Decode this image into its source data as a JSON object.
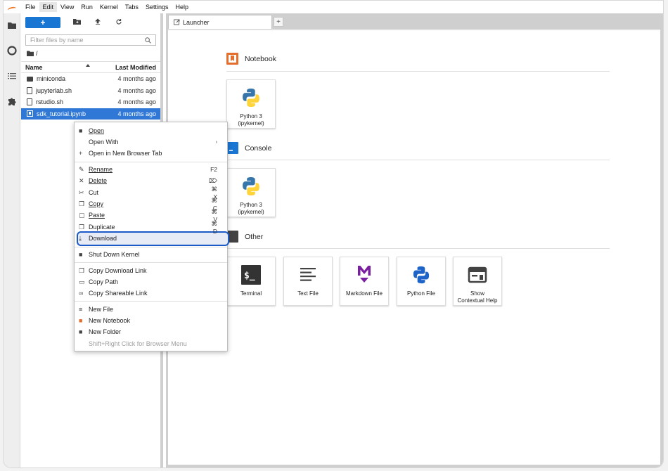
{
  "menubar": [
    "File",
    "Edit",
    "View",
    "Run",
    "Kernel",
    "Tabs",
    "Settings",
    "Help"
  ],
  "menubar_active": "Edit",
  "filebrowser": {
    "new_label": "+",
    "filter_placeholder": "Filter files by name",
    "breadcrumb": "/",
    "col_name": "Name",
    "col_modified": "Last Modified",
    "files": [
      {
        "name": "miniconda",
        "type": "folder",
        "modified": "4 months ago"
      },
      {
        "name": "jupyterlab.sh",
        "type": "file",
        "modified": "4 months ago"
      },
      {
        "name": "rstudio.sh",
        "type": "file",
        "modified": "4 months ago"
      },
      {
        "name": "sdk_tutorial.ipynb",
        "type": "notebook",
        "modified": "4 months ago"
      }
    ]
  },
  "tab": {
    "label": "Launcher",
    "add": "+"
  },
  "launcher": {
    "notebook": {
      "title": "Notebook",
      "cards": [
        {
          "label1": "Python 3",
          "label2": "(ipykernel)"
        }
      ]
    },
    "console": {
      "title": "Console",
      "cards": [
        {
          "label1": "Python 3",
          "label2": "(ipykernel)"
        }
      ]
    },
    "other": {
      "title": "Other",
      "cards": [
        {
          "label1": "Terminal",
          "label2": ""
        },
        {
          "label1": "Text File",
          "label2": ""
        },
        {
          "label1": "Markdown File",
          "label2": ""
        },
        {
          "label1": "Python File",
          "label2": ""
        },
        {
          "label1": "Show",
          "label2": "Contextual Help"
        }
      ]
    }
  },
  "context_menu": {
    "open": "Open",
    "open_with": "Open With",
    "open_new_tab": "Open in New Browser Tab",
    "rename": "Rename",
    "rename_key": "F2",
    "delete": "Delete",
    "delete_key": "⌦",
    "cut": "Cut",
    "cut_key": "⌘ X",
    "copy": "Copy",
    "copy_key": "⌘ C",
    "paste": "Paste",
    "paste_key": "⌘ V",
    "duplicate": "Duplicate",
    "duplicate_key": "⌘ D",
    "download": "Download",
    "shutdown": "Shut Down Kernel",
    "copy_download_link": "Copy Download Link",
    "copy_path": "Copy Path",
    "copy_shareable": "Copy Shareable Link",
    "new_file": "New File",
    "new_notebook": "New Notebook",
    "new_folder": "New Folder",
    "hint": "Shift+Right Click for Browser Menu"
  },
  "colors": {
    "accent": "#1976d2",
    "selection": "#2f78d6",
    "highlight_border": "#1c5bc7",
    "notebook_icon": "#e46e2e",
    "console_icon": "#1976d2",
    "markdown_icon": "#7b1fa2"
  }
}
